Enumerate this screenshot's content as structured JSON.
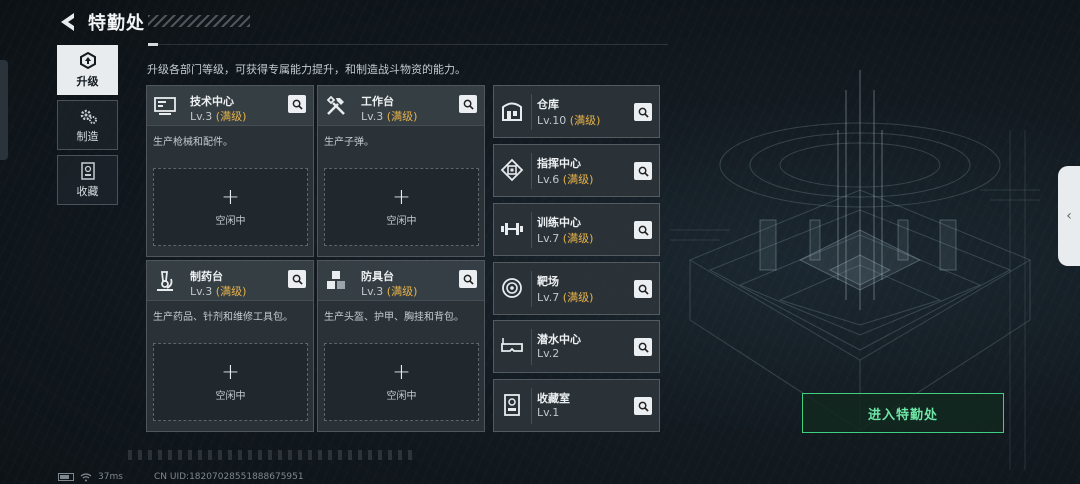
{
  "header": {
    "title": "特勤处"
  },
  "sidebar": {
    "tabs": [
      {
        "label": "升级",
        "icon": "upgrade-icon",
        "active": true
      },
      {
        "label": "制造",
        "icon": "gears-icon",
        "active": false
      },
      {
        "label": "收藏",
        "icon": "collection-icon",
        "active": false
      }
    ]
  },
  "description": "升级各部门等级，可获得专属能力提升，和制造战斗物资的能力。",
  "big_cards": [
    {
      "name": "技术中心",
      "level": "Lv.3",
      "status": "(满级)",
      "desc": "生产枪械和配件。",
      "slot_label": "空闲中",
      "icon": "monitor-icon"
    },
    {
      "name": "工作台",
      "level": "Lv.3",
      "status": "(满级)",
      "desc": "生产子弹。",
      "slot_label": "空闲中",
      "icon": "tools-icon"
    },
    {
      "name": "制药台",
      "level": "Lv.3",
      "status": "(满级)",
      "desc": "生产药品、针剂和维修工具包。",
      "slot_label": "空闲中",
      "icon": "microscope-icon"
    },
    {
      "name": "防具台",
      "level": "Lv.3",
      "status": "(满级)",
      "desc": "生产头盔、护甲、胸挂和背包。",
      "slot_label": "空闲中",
      "icon": "armor-blocks-icon"
    }
  ],
  "small_cards": [
    {
      "name": "仓库",
      "level": "Lv.10",
      "status": "(满级)",
      "icon": "warehouse-icon"
    },
    {
      "name": "指挥中心",
      "level": "Lv.6",
      "status": "(满级)",
      "icon": "command-chip-icon"
    },
    {
      "name": "训练中心",
      "level": "Lv.7",
      "status": "(满级)",
      "icon": "dumbbell-icon"
    },
    {
      "name": "靶场",
      "level": "Lv.7",
      "status": "(满级)",
      "icon": "target-icon"
    },
    {
      "name": "潜水中心",
      "level": "Lv.2",
      "status": "",
      "icon": "diving-mask-icon"
    },
    {
      "name": "收藏室",
      "level": "Lv.1",
      "status": "",
      "icon": "display-case-icon"
    }
  ],
  "enter_button": "进入特勤处",
  "status_bar": {
    "ping": "37ms",
    "uid": "CN UID:18207028551888675951"
  },
  "colors": {
    "maxed": "#e6b24a",
    "enter_accent": "#3fcf83",
    "active_tab": "#e8ecee"
  }
}
